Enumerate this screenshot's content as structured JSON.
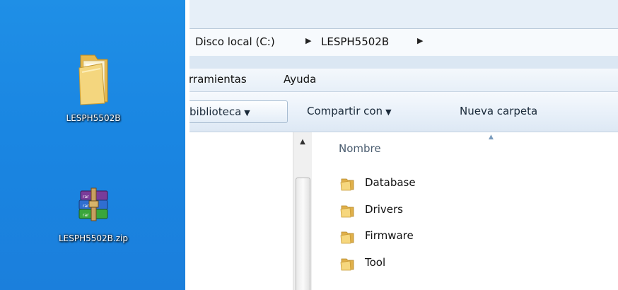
{
  "desktop": {
    "items": [
      {
        "label": "LESPH5502B",
        "icon": "folder-icon"
      },
      {
        "label": "LESPH5502B.zip",
        "icon": "winrar-archive-icon"
      }
    ]
  },
  "explorer": {
    "breadcrumb": [
      "Disco local (C:)",
      "LESPH5502B"
    ],
    "menu": [
      "rramientas",
      "Ayuda"
    ],
    "toolbar": {
      "library_label": "biblioteca",
      "share_label": "Compartir con",
      "new_folder_label": "Nueva carpeta"
    },
    "column_header": "Nombre",
    "files": [
      {
        "name": "Database",
        "icon": "folder-icon"
      },
      {
        "name": "Drivers",
        "icon": "folder-icon"
      },
      {
        "name": "Firmware",
        "icon": "folder-icon"
      },
      {
        "name": "Tool",
        "icon": "folder-icon"
      }
    ]
  },
  "colors": {
    "desktop_blue": "#1a86e2",
    "toolbar_bg": "#e8f0f9",
    "folder_yellow": "#f3d27a"
  }
}
